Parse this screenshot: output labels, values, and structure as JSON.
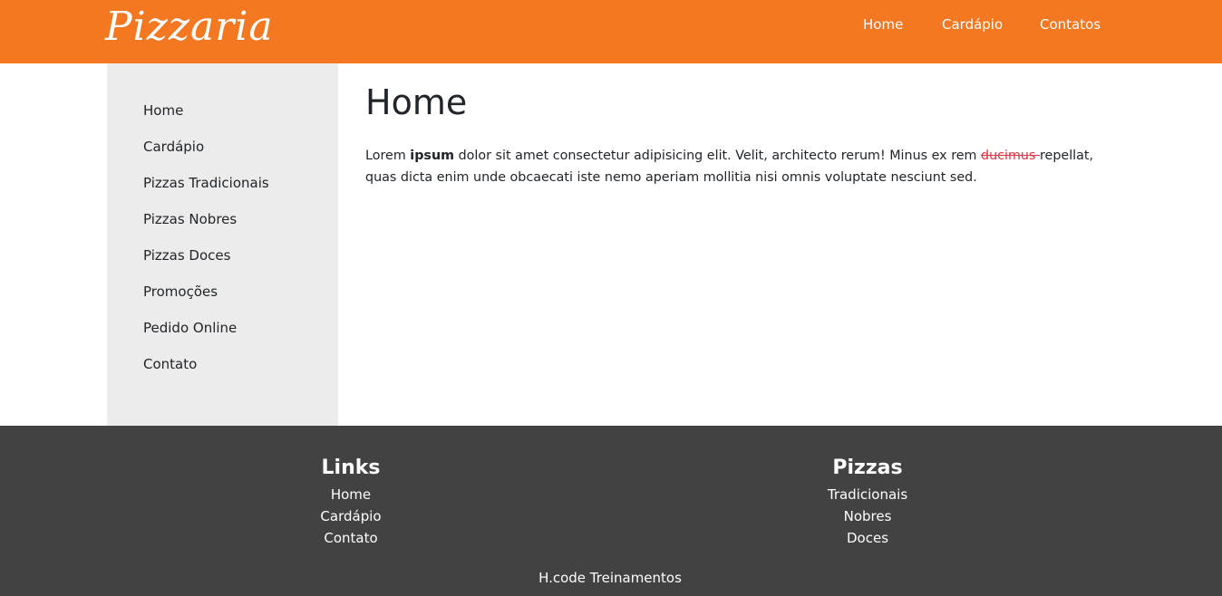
{
  "header": {
    "logo": "Pizzaria",
    "nav": [
      "Home",
      "Cardápio",
      "Contatos"
    ],
    "background": "#f47721"
  },
  "sidebar": {
    "items": [
      "Home",
      "Cardápio",
      "Pizzas Tradicionais",
      "Pizzas Nobres",
      "Pizzas Doces",
      "Promoções",
      "Pedido Online",
      "Contato"
    ]
  },
  "main": {
    "title": "Home",
    "paragraph": {
      "part1": "Lorem ",
      "bold": "ipsum",
      "part2": " dolor sit amet consectetur adipisicing elit. Velit, architecto rerum! Minus ex rem ",
      "struck": "ducimus ",
      "part3": "repellat, quas dicta enim unde obcaecati iste nemo aperiam mollitia nisi omnis voluptate nesciunt sed."
    }
  },
  "footer": {
    "links": {
      "title": "Links",
      "items": [
        "Home",
        "Cardápio",
        "Contato"
      ]
    },
    "pizzas": {
      "title": "Pizzas",
      "items": [
        "Tradicionais",
        "Nobres",
        "Doces"
      ]
    },
    "copyright": "H.code Treinamentos",
    "background": "#424242"
  }
}
